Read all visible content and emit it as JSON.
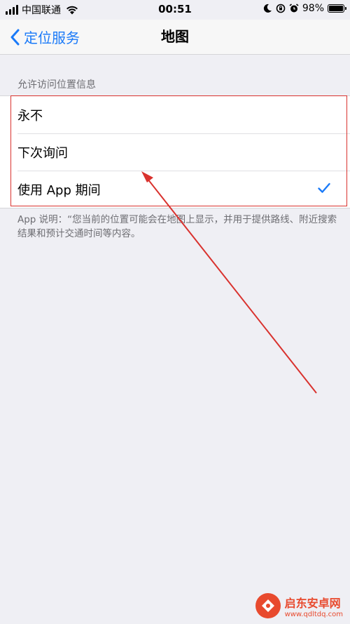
{
  "status_bar": {
    "carrier": "中国联通",
    "time": "00:51",
    "battery": "98%",
    "battery_level": 0.98
  },
  "nav": {
    "back_label": "定位服务",
    "title": "地图"
  },
  "section": {
    "header": "允许访问位置信息",
    "options": [
      {
        "label": "永不",
        "selected": false
      },
      {
        "label": "下次询问",
        "selected": false
      },
      {
        "label": "使用 App 期间",
        "selected": true
      }
    ],
    "footer": "App 说明：“您当前的位置可能会在地图上显示，并用于提供路线、附近搜索结果和预计交通时间等内容。"
  },
  "colors": {
    "accent": "#1a7af8",
    "annotation": "#d9322e",
    "background": "#efeff4"
  },
  "watermark": {
    "name": "启东安卓网",
    "url": "www.qdltdq.com"
  }
}
